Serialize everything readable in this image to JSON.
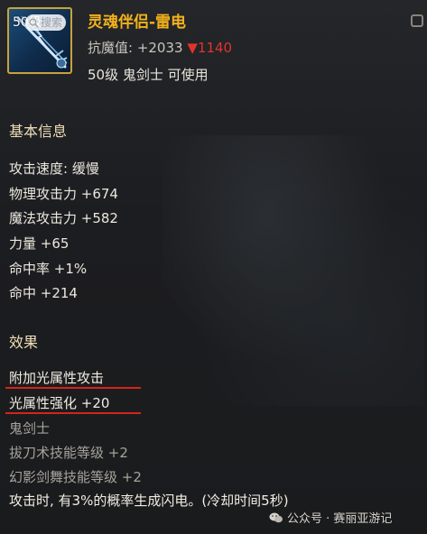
{
  "item": {
    "level_badge": "50级",
    "search_hint": "搜索",
    "name": "灵魂伴侣-雷电",
    "anti_magic_label": "抗魔值: +2033",
    "anti_magic_delta": "▼1140",
    "requirement": "50级 鬼剑士 可使用"
  },
  "basic": {
    "header": "基本信息",
    "stats": [
      "攻击速度: 缓慢",
      "物理攻击力 +674",
      "魔法攻击力 +582",
      "力量 +65",
      "命中率 +1%",
      "命中 +214"
    ]
  },
  "effects": {
    "header": "效果",
    "lines": [
      "附加光属性攻击",
      "光属性强化 +20",
      "鬼剑士",
      "拔刀术技能等级 +2",
      "幻影剑舞技能等级 +2",
      "攻击时, 有3%的概率生成闪电。(冷却时间5秒)"
    ]
  },
  "watermark": "公众号 · 赛丽亚游记",
  "colors": {
    "title": "#f2b21c",
    "decrease": "#e0342b",
    "highlight_underline": "#d5241c",
    "icon_border": "#c9a23a"
  },
  "icons": [
    "search-icon",
    "weapon-icon",
    "expand-icon",
    "wechat-icon"
  ]
}
